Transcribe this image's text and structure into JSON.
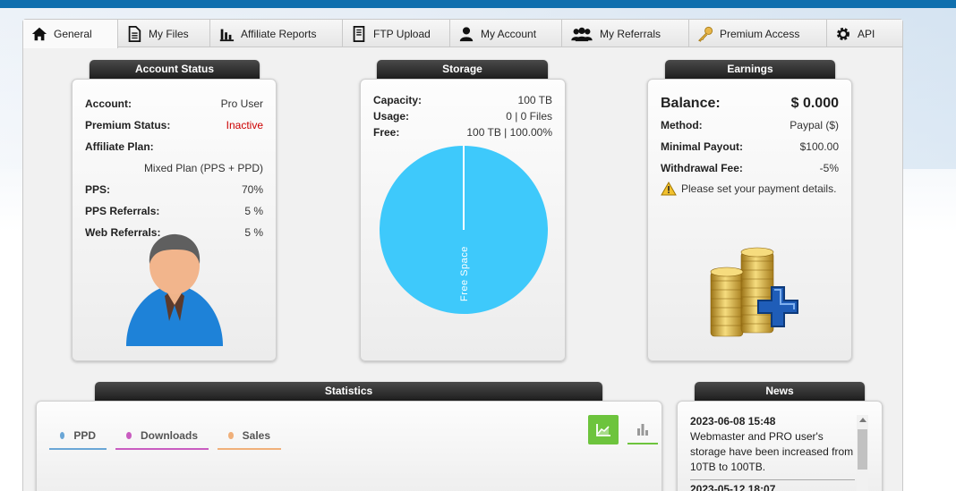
{
  "tabs": [
    {
      "label": "General",
      "icon": "home-icon",
      "active": true
    },
    {
      "label": "My Files",
      "icon": "file-icon"
    },
    {
      "label": "Affiliate Reports",
      "icon": "bar-chart-icon"
    },
    {
      "label": "FTP Upload",
      "icon": "server-icon"
    },
    {
      "label": "My Account",
      "icon": "user-icon"
    },
    {
      "label": "My Referrals",
      "icon": "users-icon"
    },
    {
      "label": "Premium Access",
      "icon": "key-icon"
    },
    {
      "label": "API",
      "icon": "gear-icon"
    }
  ],
  "account": {
    "title": "Account Status",
    "rows": [
      {
        "k": "Account:",
        "v": "Pro User"
      },
      {
        "k": "Premium Status:",
        "v": "Inactive"
      },
      {
        "k": "Affiliate Plan:",
        "v": ""
      }
    ],
    "plan_value": "Mixed Plan (PPS + PPD)",
    "rows2": [
      {
        "k": "PPS:",
        "v": "70%"
      },
      {
        "k": "PPS Referrals:",
        "v": "5 %"
      },
      {
        "k": "Web Referrals:",
        "v": "5 %"
      }
    ]
  },
  "storage": {
    "title": "Storage",
    "rows": [
      {
        "k": "Capacity:",
        "v": "100 TB"
      },
      {
        "k": "Usage:",
        "v": "0 | 0 Files"
      },
      {
        "k": "Free:",
        "v": "100 TB | 100.00%"
      }
    ],
    "pie_label": "Free Space",
    "pie_color": "#3ec9fb"
  },
  "earnings": {
    "title": "Earnings",
    "balance_label": "Balance:",
    "balance_value": "$ 0.000",
    "rows": [
      {
        "k": "Method:",
        "v": "Paypal ($)"
      },
      {
        "k": "Minimal Payout:",
        "v": "$100.00"
      },
      {
        "k": "Withdrawal Fee:",
        "v": "-5%"
      }
    ],
    "warning": "Please set your payment details."
  },
  "statistics": {
    "title": "Statistics",
    "tabs": [
      {
        "label": "PPD",
        "color": "#6aa6d6"
      },
      {
        "label": "Downloads",
        "color": "#c95cc0"
      },
      {
        "label": "Sales",
        "color": "#f0b07a"
      }
    ],
    "accent": "#6dc43d"
  },
  "news": {
    "title": "News",
    "items": [
      {
        "date": "2023-06-08 15:48",
        "text": "Webmaster and PRO user's storage have been increased from 10TB to 100TB."
      },
      {
        "date": "2023-05-12 18:07",
        "text": ""
      }
    ]
  }
}
